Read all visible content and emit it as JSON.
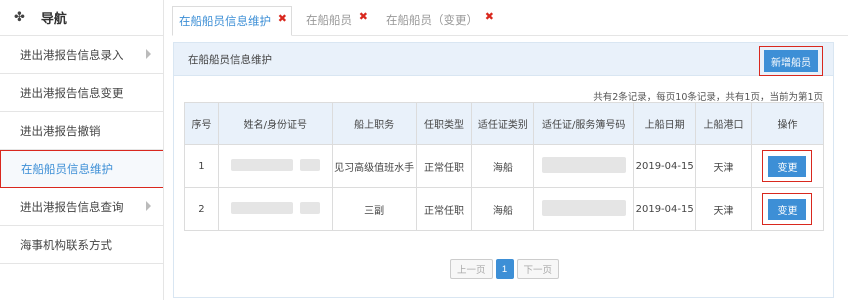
{
  "sidebar": {
    "title": "导航",
    "home_icon": "home-icon",
    "items": [
      {
        "label": "进出港报告信息录入",
        "has_arrow": true
      },
      {
        "label": "进出港报告信息变更",
        "has_arrow": false
      },
      {
        "label": "进出港报告撤销",
        "has_arrow": false
      },
      {
        "label": "在船船员信息维护",
        "has_arrow": false,
        "active": true
      },
      {
        "label": "进出港报告信息查询",
        "has_arrow": true
      },
      {
        "label": "海事机构联系方式",
        "has_arrow": false
      }
    ]
  },
  "tabs": [
    {
      "label": "在船船员信息维护",
      "active": true
    },
    {
      "label": "在船船员",
      "active": false
    },
    {
      "label": "在船船员（变更）",
      "active": false
    }
  ],
  "panel": {
    "title": "在船船员信息维护",
    "add_button": "新增船员",
    "summary": "共有2条记录，每页10条记录，共有1页，当前为第1页"
  },
  "table": {
    "headers": [
      "序号",
      "姓名/身份证号",
      "船上职务",
      "任职类型",
      "适任证类别",
      "适任证/服务簿号码",
      "上船日期",
      "上船港口",
      "操作"
    ],
    "rows": [
      {
        "index": "1",
        "name": "",
        "position": "见习高级值班水手",
        "type": "正常任职",
        "cert": "海船",
        "cert_no": "",
        "date": "2019-04-15",
        "port": "天津",
        "action": "变更"
      },
      {
        "index": "2",
        "name": "",
        "position": "三副",
        "type": "正常任职",
        "cert": "海船",
        "cert_no": "",
        "date": "2019-04-15",
        "port": "天津",
        "action": "变更"
      }
    ]
  },
  "pager": {
    "prev": "上一页",
    "current": "1",
    "next": "下一页"
  },
  "colors": {
    "accent": "#3d8fd6",
    "highlight": "#d9281e",
    "header_bg": "#e9f1fa"
  }
}
